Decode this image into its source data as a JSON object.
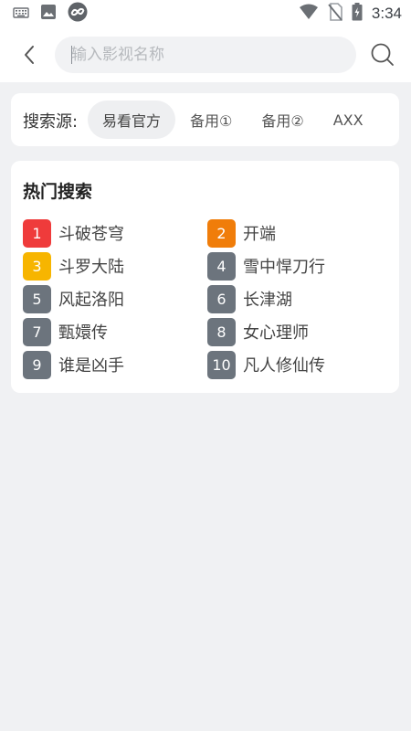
{
  "status_bar": {
    "time": "3:34",
    "left_icons": [
      "keyboard-icon",
      "image-icon",
      "app-infinity-icon"
    ],
    "right_icons": [
      "wifi-icon",
      "no-sim-icon",
      "battery-charging-icon"
    ]
  },
  "search": {
    "placeholder": "输入影视名称",
    "value": ""
  },
  "sources": {
    "label": "搜索源:",
    "tabs": [
      "易看官方",
      "备用①",
      "备用②",
      "AXX"
    ],
    "active_index": 0
  },
  "hot": {
    "title": "热门搜索",
    "items": [
      {
        "rank": "1",
        "name": "斗破苍穹"
      },
      {
        "rank": "2",
        "name": "开端"
      },
      {
        "rank": "3",
        "name": "斗罗大陆"
      },
      {
        "rank": "4",
        "name": "雪中悍刀行"
      },
      {
        "rank": "5",
        "name": "风起洛阳"
      },
      {
        "rank": "6",
        "name": "长津湖"
      },
      {
        "rank": "7",
        "name": "甄嬛传"
      },
      {
        "rank": "8",
        "name": "女心理师"
      },
      {
        "rank": "9",
        "name": "谁是凶手"
      },
      {
        "rank": "10",
        "name": "凡人修仙传"
      }
    ]
  },
  "colors": {
    "rank1": "#ef3b3b",
    "rank2": "#f07d0a",
    "rank3": "#f7b500",
    "rank_default": "#6c747d",
    "background": "#f0f1f3"
  }
}
